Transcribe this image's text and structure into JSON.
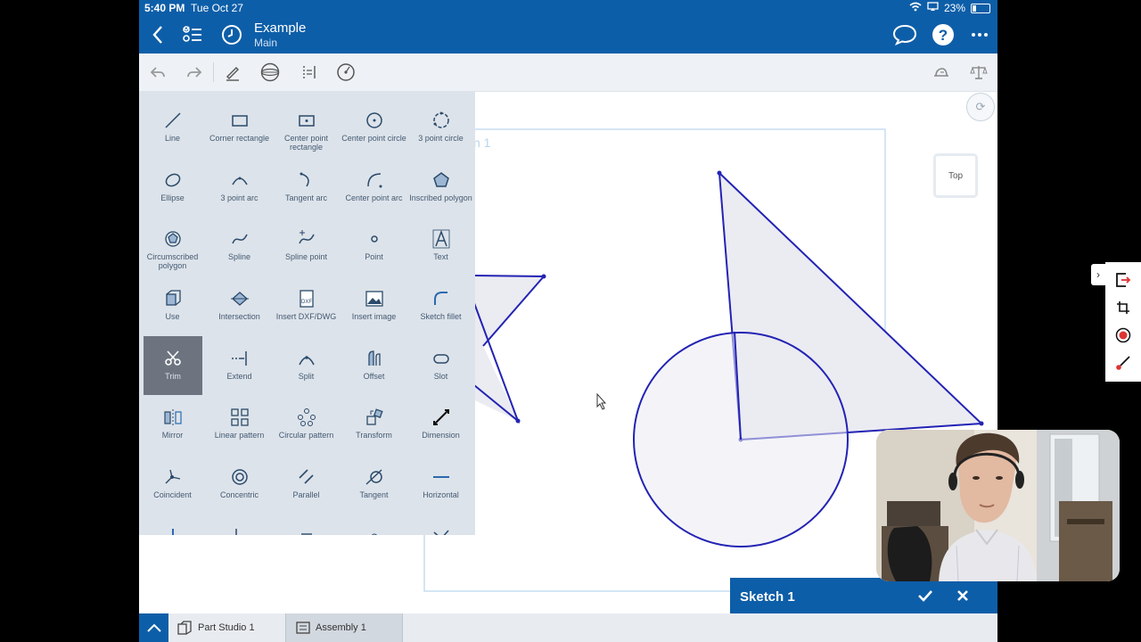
{
  "status_bar": {
    "time": "5:40 PM",
    "date": "Tue Oct 27",
    "battery": "23%"
  },
  "title_bar": {
    "title": "Example",
    "subtitle": "Main",
    "icons": [
      "back-icon",
      "feature-list-icon",
      "history-icon",
      "comment-icon",
      "help-icon",
      "more-icon"
    ]
  },
  "toolbar": {
    "icons": [
      "undo-icon",
      "redo-icon",
      "sketch-pencil-icon",
      "view-sphere-icon",
      "dimension-tool-icon",
      "center-circle-tool-icon",
      "hat-icon",
      "balance-icon"
    ]
  },
  "tools": [
    "Line",
    "Corner rectangle",
    "Center point rectangle",
    "Center point circle",
    "3 point circle",
    "Ellipse",
    "3 point arc",
    "Tangent arc",
    "Center point arc",
    "Inscribed polygon",
    "Circumscribed polygon",
    "Spline",
    "Spline point",
    "Point",
    "Text",
    "Use",
    "Intersection",
    "Insert DXF/DWG",
    "Insert image",
    "Sketch fillet",
    "Trim",
    "Extend",
    "Split",
    "Offset",
    "Slot",
    "Mirror",
    "Linear pattern",
    "Circular pattern",
    "Transform",
    "Dimension",
    "Coincident",
    "Concentric",
    "Parallel",
    "Tangent",
    "Horizontal"
  ],
  "active_tool": "Trim",
  "canvas": {
    "view_cube_label": "Top",
    "plane_label": "n 1"
  },
  "sketch_bar": {
    "name": "Sketch 1"
  },
  "bottom_tabs": [
    {
      "label": "Part Studio 1"
    },
    {
      "label": "Assembly 1"
    }
  ],
  "colors": {
    "brand_blue": "#0d5ea8",
    "sketch_line": "#2323b4",
    "panel_bg": "#dde3ea"
  }
}
